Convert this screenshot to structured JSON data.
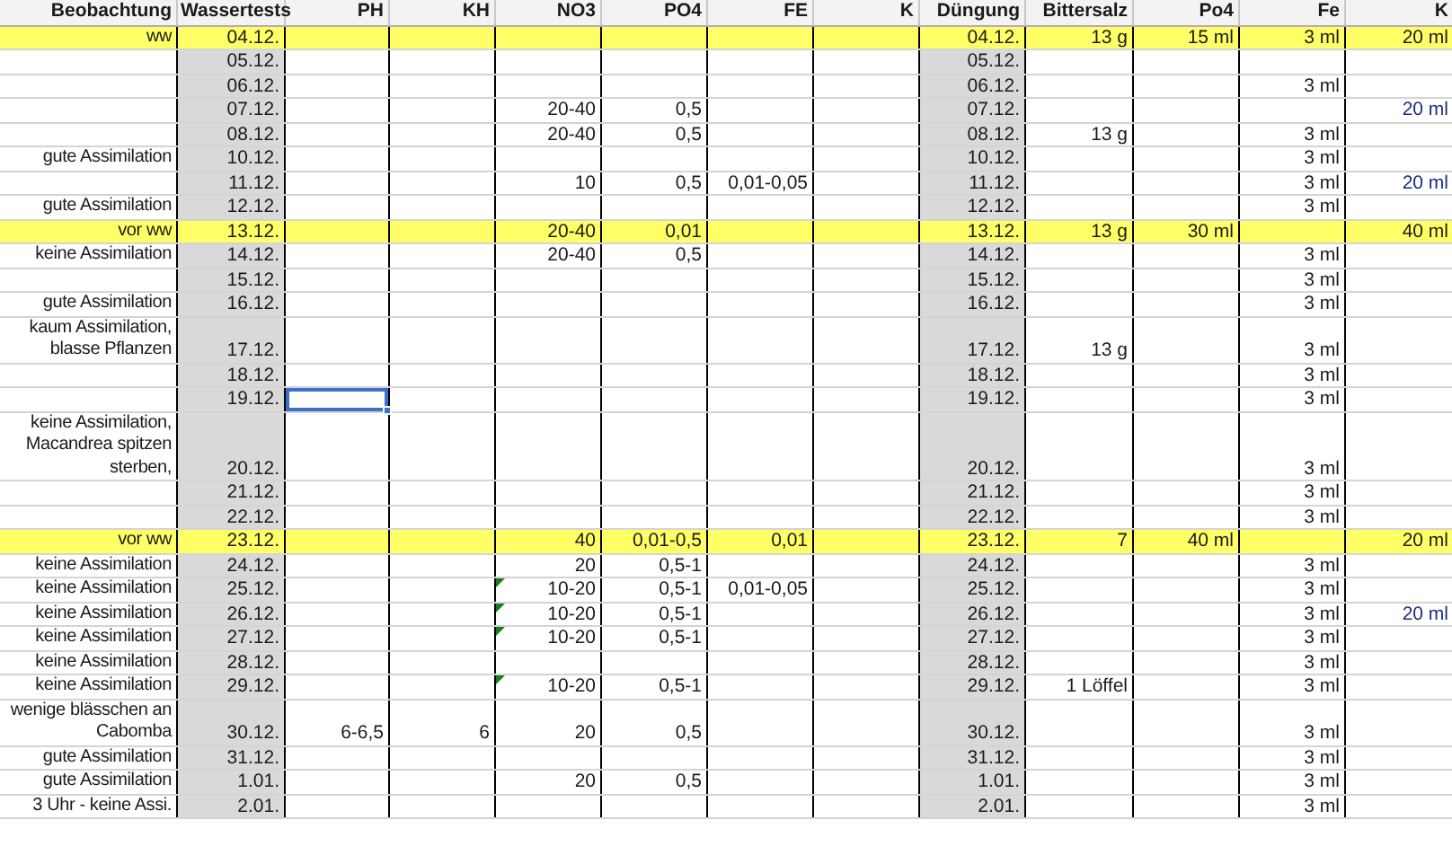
{
  "table": {
    "columns": [
      "Beobachtung",
      "Wassertests",
      "PH",
      "KH",
      "NO3",
      "PO4",
      "FE",
      "K",
      "Düngung",
      "Bittersalz",
      "Po4",
      "Fe",
      "K"
    ],
    "rows": [
      {
        "highlight": true,
        "cells": [
          "ww",
          "04.12.",
          null,
          null,
          null,
          null,
          null,
          null,
          "04.12.",
          "13 g",
          "15 ml",
          "3 ml",
          "20 ml"
        ]
      },
      {
        "highlight": false,
        "cells": [
          null,
          "05.12.",
          null,
          null,
          null,
          null,
          null,
          null,
          "05.12.",
          null,
          null,
          null,
          null
        ]
      },
      {
        "highlight": false,
        "cells": [
          null,
          "06.12.",
          null,
          null,
          null,
          null,
          null,
          null,
          "06.12.",
          null,
          null,
          "3 ml",
          null
        ]
      },
      {
        "highlight": false,
        "cells": [
          null,
          "07.12.",
          null,
          null,
          "20-40",
          "0,5",
          null,
          null,
          "07.12.",
          null,
          null,
          null,
          "20 ml"
        ]
      },
      {
        "highlight": false,
        "cells": [
          null,
          "08.12.",
          null,
          null,
          "20-40",
          "0,5",
          null,
          null,
          "08.12.",
          "13 g",
          null,
          "3 ml",
          null
        ]
      },
      {
        "highlight": false,
        "cells": [
          "gute Assimilation",
          "10.12.",
          null,
          null,
          null,
          null,
          null,
          null,
          "10.12.",
          null,
          null,
          "3 ml",
          null
        ]
      },
      {
        "highlight": false,
        "cells": [
          null,
          "11.12.",
          null,
          null,
          "10",
          "0,5",
          "0,01-0,05",
          null,
          "11.12.",
          null,
          null,
          "3 ml",
          "20 ml"
        ]
      },
      {
        "highlight": false,
        "cells": [
          "gute Assimilation",
          "12.12.",
          null,
          null,
          null,
          null,
          null,
          null,
          "12.12.",
          null,
          null,
          "3 ml",
          null
        ]
      },
      {
        "highlight": true,
        "cells": [
          "vor ww",
          "13.12.",
          null,
          null,
          "20-40",
          "0,01",
          null,
          null,
          "13.12.",
          "13 g",
          "30 ml",
          null,
          "40 ml"
        ]
      },
      {
        "highlight": false,
        "cells": [
          "keine Assimilation",
          "14.12.",
          null,
          null,
          "20-40",
          "0,5",
          null,
          null,
          "14.12.",
          null,
          null,
          "3 ml",
          null
        ]
      },
      {
        "highlight": false,
        "cells": [
          null,
          "15.12.",
          null,
          null,
          null,
          null,
          null,
          null,
          "15.12.",
          null,
          null,
          "3 ml",
          null
        ]
      },
      {
        "highlight": false,
        "cells": [
          "gute Assimilation",
          "16.12.",
          null,
          null,
          null,
          null,
          null,
          null,
          "16.12.",
          null,
          null,
          "3 ml",
          null
        ]
      },
      {
        "highlight": false,
        "cells": [
          "kaum Assimilation,\nblasse Pflanzen",
          "17.12.",
          null,
          null,
          null,
          null,
          null,
          null,
          "17.12.",
          "13 g",
          null,
          "3 ml",
          null
        ]
      },
      {
        "highlight": false,
        "cells": [
          null,
          "18.12.",
          null,
          null,
          null,
          null,
          null,
          null,
          "18.12.",
          null,
          null,
          "3 ml",
          null
        ]
      },
      {
        "highlight": false,
        "cells": [
          null,
          "19.12.",
          {
            "selected": true
          },
          null,
          null,
          null,
          null,
          null,
          "19.12.",
          null,
          null,
          "3 ml",
          null
        ]
      },
      {
        "highlight": false,
        "cells": [
          "keine Assimilation,\nMacandrea spitzen\nsterben,",
          "20.12.",
          null,
          null,
          null,
          null,
          null,
          null,
          "20.12.",
          null,
          null,
          "3 ml",
          null
        ]
      },
      {
        "highlight": false,
        "cells": [
          null,
          "21.12.",
          null,
          null,
          null,
          null,
          null,
          null,
          "21.12.",
          null,
          null,
          "3 ml",
          null
        ]
      },
      {
        "highlight": false,
        "cells": [
          null,
          "22.12.",
          null,
          null,
          null,
          null,
          null,
          null,
          "22.12.",
          null,
          null,
          "3 ml",
          null
        ]
      },
      {
        "highlight": true,
        "cells": [
          "vor ww",
          "23.12.",
          null,
          null,
          "40",
          "0,01-0,5",
          "0,01",
          null,
          "23.12.",
          "7",
          "40 ml",
          null,
          "20 ml"
        ]
      },
      {
        "highlight": false,
        "cells": [
          "keine Assimilation",
          "24.12.",
          null,
          null,
          "20",
          "0,5-1",
          null,
          null,
          "24.12.",
          null,
          null,
          "3 ml",
          null
        ]
      },
      {
        "highlight": false,
        "cells": [
          "keine Assimilation",
          "25.12.",
          null,
          null,
          {
            "text": "10-20",
            "flagged": true
          },
          "0,5-1",
          "0,01-0,05",
          null,
          "25.12.",
          null,
          null,
          "3 ml",
          null
        ]
      },
      {
        "highlight": false,
        "cells": [
          "keine Assimilation",
          "26.12.",
          null,
          null,
          {
            "text": "10-20",
            "flagged": true
          },
          "0,5-1",
          null,
          null,
          "26.12.",
          null,
          null,
          "3 ml",
          "20 ml"
        ]
      },
      {
        "highlight": false,
        "cells": [
          "keine Assimilation",
          "27.12.",
          null,
          null,
          {
            "text": "10-20",
            "flagged": true
          },
          "0,5-1",
          null,
          null,
          "27.12.",
          null,
          null,
          "3 ml",
          null
        ]
      },
      {
        "highlight": false,
        "cells": [
          "keine Assimilation",
          "28.12.",
          null,
          null,
          null,
          null,
          null,
          null,
          "28.12.",
          null,
          null,
          "3 ml",
          null
        ]
      },
      {
        "highlight": false,
        "cells": [
          "keine Assimilation",
          "29.12.",
          null,
          null,
          {
            "text": "10-20",
            "flagged": true
          },
          "0,5-1",
          null,
          null,
          "29.12.",
          "1 Löffel",
          null,
          "3 ml",
          null
        ]
      },
      {
        "highlight": false,
        "cells": [
          "wenige blässchen an\nCabomba",
          "30.12.",
          "6-6,5",
          "6",
          "20",
          "0,5",
          null,
          null,
          "30.12.",
          null,
          null,
          "3 ml",
          null
        ]
      },
      {
        "highlight": false,
        "cells": [
          "gute Assimilation",
          "31.12.",
          null,
          null,
          null,
          null,
          null,
          null,
          "31.12.",
          null,
          null,
          "3 ml",
          null
        ]
      },
      {
        "highlight": false,
        "cells": [
          "gute Assimilation",
          "1.01.",
          null,
          null,
          "20",
          "0,5",
          null,
          null,
          "1.01.",
          null,
          null,
          "3 ml",
          null
        ]
      },
      {
        "highlight": false,
        "cells": [
          "3 Uhr - keine Assi.",
          "2.01.",
          null,
          null,
          null,
          null,
          null,
          null,
          "2.01.",
          null,
          null,
          "3 ml",
          null
        ]
      }
    ]
  }
}
